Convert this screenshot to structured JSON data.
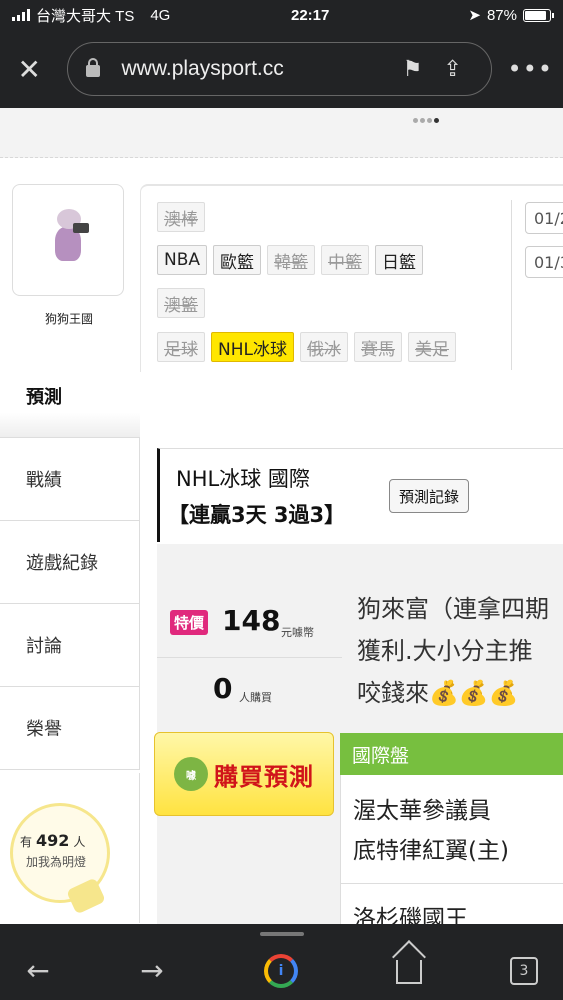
{
  "status_bar": {
    "carrier": "台灣大哥大 TS",
    "network": "4G",
    "time": "22:17",
    "battery": "87%",
    "battery_level": 0.87
  },
  "browser": {
    "url": "www.playsport.cc",
    "tab_count": "3"
  },
  "profile": {
    "name": "狗狗王國"
  },
  "sidebar": {
    "items": [
      {
        "label": "預測"
      },
      {
        "label": "戰績"
      },
      {
        "label": "遊戲紀錄"
      },
      {
        "label": "討論"
      },
      {
        "label": "榮譽"
      }
    ]
  },
  "fans": {
    "prefix": "有",
    "count": "492",
    "suffix": "人",
    "caption": "加我為明燈"
  },
  "categories": {
    "row1": [
      {
        "label": "澳棒",
        "disabled": true
      }
    ],
    "row2": [
      {
        "label": "NBA",
        "disabled": false
      },
      {
        "label": "歐籃",
        "disabled": false
      },
      {
        "label": "韓籃",
        "disabled": true
      },
      {
        "label": "中籃",
        "disabled": true
      },
      {
        "label": "日籃",
        "disabled": false
      }
    ],
    "row3": [
      {
        "label": "澳籃",
        "disabled": true
      }
    ],
    "row4": [
      {
        "label": "足球",
        "disabled": true
      },
      {
        "label": "NHL冰球",
        "selected": true
      },
      {
        "label": "俄冰",
        "disabled": true
      },
      {
        "label": "賽馬",
        "disabled": true
      },
      {
        "label": "美足",
        "disabled": true
      }
    ]
  },
  "dates": [
    "01/2",
    "01/3"
  ],
  "game_header": {
    "title": "NHL冰球 國際",
    "streak": "【連贏3天 3過3】",
    "record_button": "預測記錄"
  },
  "offer": {
    "special_label": "特價",
    "price": "148",
    "price_unit": "元噱幣",
    "buyers": "0",
    "buyers_unit": "人購買",
    "buy_button": "購買預測",
    "buy_icon": "噱"
  },
  "description": {
    "line1": "狗來富（連拿四期",
    "line2": "獲利.大小分主推",
    "line3": "咬錢來💰💰💰"
  },
  "league": {
    "label": "國際盤"
  },
  "matches": {
    "team1_line1": "渥太華參議員",
    "team1_line2": "底特律紅翼(主)",
    "team2": "洛杉磯國王"
  }
}
